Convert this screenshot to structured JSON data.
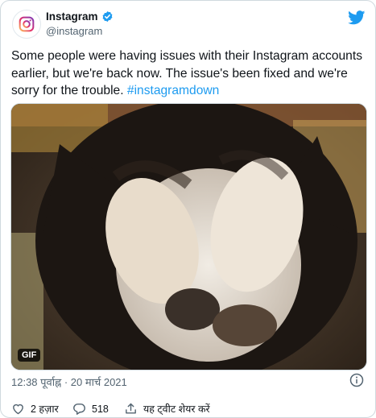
{
  "account": {
    "name": "Instagram",
    "handle": "@instagram",
    "verified": true
  },
  "tweet": {
    "text": "Some people were having issues with their Instagram accounts earlier, but we're back now. The issue's been fixed and we're sorry for the trouble.",
    "hashtag": "#instagramdown"
  },
  "media": {
    "badge": "GIF"
  },
  "meta": {
    "timestamp": "12:38 पूर्वाह्न · 20 मार्च 2021"
  },
  "actions": {
    "likes": "2 हज़ार",
    "replies": "518",
    "share_label": "यह ट्वीट शेयर करें"
  },
  "colors": {
    "accent": "#1d9bf0",
    "text": "#0f1419",
    "muted": "#536471",
    "border": "#cfd9de"
  },
  "icons": [
    "instagram-logo-icon",
    "verified-badge-icon",
    "twitter-bird-icon",
    "info-icon",
    "heart-icon",
    "reply-icon",
    "share-icon"
  ]
}
